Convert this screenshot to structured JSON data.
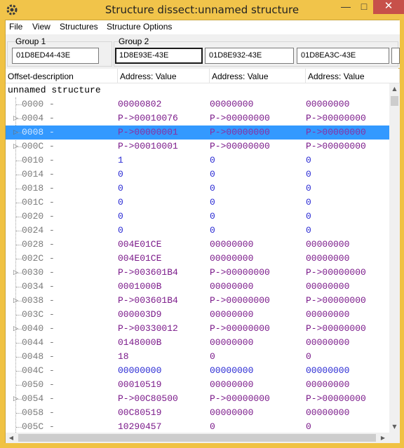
{
  "window": {
    "title": "Structure dissect:unnamed structure",
    "minimize": "—",
    "maximize": "□",
    "close": "✕"
  },
  "menu": [
    "File",
    "View",
    "Structures",
    "Structure Options"
  ],
  "groups": [
    {
      "label": "Group 1",
      "addresses": [
        "01D8ED44-43E"
      ]
    },
    {
      "label": "Group 2",
      "addresses": [
        "1D8E93E-43E",
        "01D8E932-43E",
        "01D8EA3C-43E"
      ]
    }
  ],
  "columns": [
    "Offset-description",
    "Address: Value",
    "Address: Value",
    "Address: Value"
  ],
  "structure_name": "unnamed structure",
  "rows": [
    {
      "offset": "0000 -",
      "expandable": false,
      "selected": false,
      "v1": "00000802",
      "v2": "00000000",
      "v3": "00000000",
      "c1": "purple",
      "c2": "purple",
      "c3": "purple"
    },
    {
      "offset": "0004 -",
      "expandable": true,
      "selected": false,
      "v1": "P->00010076",
      "v2": "P->00000000",
      "v3": "P->00000000",
      "c1": "purple",
      "c2": "purple",
      "c3": "purple"
    },
    {
      "offset": "0008 -",
      "expandable": true,
      "selected": true,
      "v1": "P->00000001",
      "v2": "P->00000000",
      "v3": "P->00000000",
      "c1": "purple",
      "c2": "purple",
      "c3": "purple"
    },
    {
      "offset": "000C -",
      "expandable": true,
      "selected": false,
      "v1": "P->00010001",
      "v2": "P->00000000",
      "v3": "P->00000000",
      "c1": "purple",
      "c2": "purple",
      "c3": "purple"
    },
    {
      "offset": "0010 -",
      "expandable": false,
      "selected": false,
      "v1": "1",
      "v2": "0",
      "v3": "0",
      "c1": "blue",
      "c2": "blue",
      "c3": "blue"
    },
    {
      "offset": "0014 -",
      "expandable": false,
      "selected": false,
      "v1": "0",
      "v2": "0",
      "v3": "0",
      "c1": "blue",
      "c2": "blue",
      "c3": "blue"
    },
    {
      "offset": "0018 -",
      "expandable": false,
      "selected": false,
      "v1": "0",
      "v2": "0",
      "v3": "0",
      "c1": "blue",
      "c2": "blue",
      "c3": "blue"
    },
    {
      "offset": "001C -",
      "expandable": false,
      "selected": false,
      "v1": "0",
      "v2": "0",
      "v3": "0",
      "c1": "blue",
      "c2": "blue",
      "c3": "blue"
    },
    {
      "offset": "0020 -",
      "expandable": false,
      "selected": false,
      "v1": "0",
      "v2": "0",
      "v3": "0",
      "c1": "blue",
      "c2": "blue",
      "c3": "blue"
    },
    {
      "offset": "0024 -",
      "expandable": false,
      "selected": false,
      "v1": "0",
      "v2": "0",
      "v3": "0",
      "c1": "blue",
      "c2": "blue",
      "c3": "blue"
    },
    {
      "offset": "0028 -",
      "expandable": false,
      "selected": false,
      "v1": "004E01CE",
      "v2": "00000000",
      "v3": "00000000",
      "c1": "purple",
      "c2": "purple",
      "c3": "purple"
    },
    {
      "offset": "002C -",
      "expandable": false,
      "selected": false,
      "v1": "004E01CE",
      "v2": "00000000",
      "v3": "00000000",
      "c1": "purple",
      "c2": "purple",
      "c3": "purple"
    },
    {
      "offset": "0030 -",
      "expandable": true,
      "selected": false,
      "v1": "P->003601B4",
      "v2": "P->00000000",
      "v3": "P->00000000",
      "c1": "purple",
      "c2": "purple",
      "c3": "purple"
    },
    {
      "offset": "0034 -",
      "expandable": false,
      "selected": false,
      "v1": "0001000B",
      "v2": "00000000",
      "v3": "00000000",
      "c1": "purple",
      "c2": "purple",
      "c3": "purple"
    },
    {
      "offset": "0038 -",
      "expandable": true,
      "selected": false,
      "v1": "P->003601B4",
      "v2": "P->00000000",
      "v3": "P->00000000",
      "c1": "purple",
      "c2": "purple",
      "c3": "purple"
    },
    {
      "offset": "003C -",
      "expandable": false,
      "selected": false,
      "v1": "000003D9",
      "v2": "00000000",
      "v3": "00000000",
      "c1": "purple",
      "c2": "purple",
      "c3": "purple"
    },
    {
      "offset": "0040 -",
      "expandable": true,
      "selected": false,
      "v1": "P->00330012",
      "v2": "P->00000000",
      "v3": "P->00000000",
      "c1": "purple",
      "c2": "purple",
      "c3": "purple"
    },
    {
      "offset": "0044 -",
      "expandable": false,
      "selected": false,
      "v1": "0148000B",
      "v2": "00000000",
      "v3": "00000000",
      "c1": "purple",
      "c2": "purple",
      "c3": "purple"
    },
    {
      "offset": "0048 -",
      "expandable": false,
      "selected": false,
      "v1": "18",
      "v2": "0",
      "v3": "0",
      "c1": "purple",
      "c2": "purple",
      "c3": "purple"
    },
    {
      "offset": "004C -",
      "expandable": false,
      "selected": false,
      "v1": "00000000",
      "v2": "00000000",
      "v3": "00000000",
      "c1": "blue",
      "c2": "blue",
      "c3": "blue"
    },
    {
      "offset": "0050 -",
      "expandable": false,
      "selected": false,
      "v1": "00010519",
      "v2": "00000000",
      "v3": "00000000",
      "c1": "purple",
      "c2": "purple",
      "c3": "purple"
    },
    {
      "offset": "0054 -",
      "expandable": true,
      "selected": false,
      "v1": "P->00C80500",
      "v2": "P->00000000",
      "v3": "P->00000000",
      "c1": "purple",
      "c2": "purple",
      "c3": "purple"
    },
    {
      "offset": "0058 -",
      "expandable": false,
      "selected": false,
      "v1": "00C80519",
      "v2": "00000000",
      "v3": "00000000",
      "c1": "purple",
      "c2": "purple",
      "c3": "purple"
    },
    {
      "offset": "005C -",
      "expandable": false,
      "selected": false,
      "v1": "10290457",
      "v2": "0",
      "v3": "0",
      "c1": "purple",
      "c2": "purple",
      "c3": "purple"
    }
  ],
  "scroll": {
    "up": "▲",
    "down": "▼",
    "left": "◀",
    "right": "▶"
  },
  "icons": {
    "app": "cheat-engine-gear-icon"
  },
  "colors": {
    "selection": "#3399ff",
    "pointer_value": "#7b1a8a",
    "int_value": "#2b2bd4",
    "frame": "#f0c243"
  }
}
